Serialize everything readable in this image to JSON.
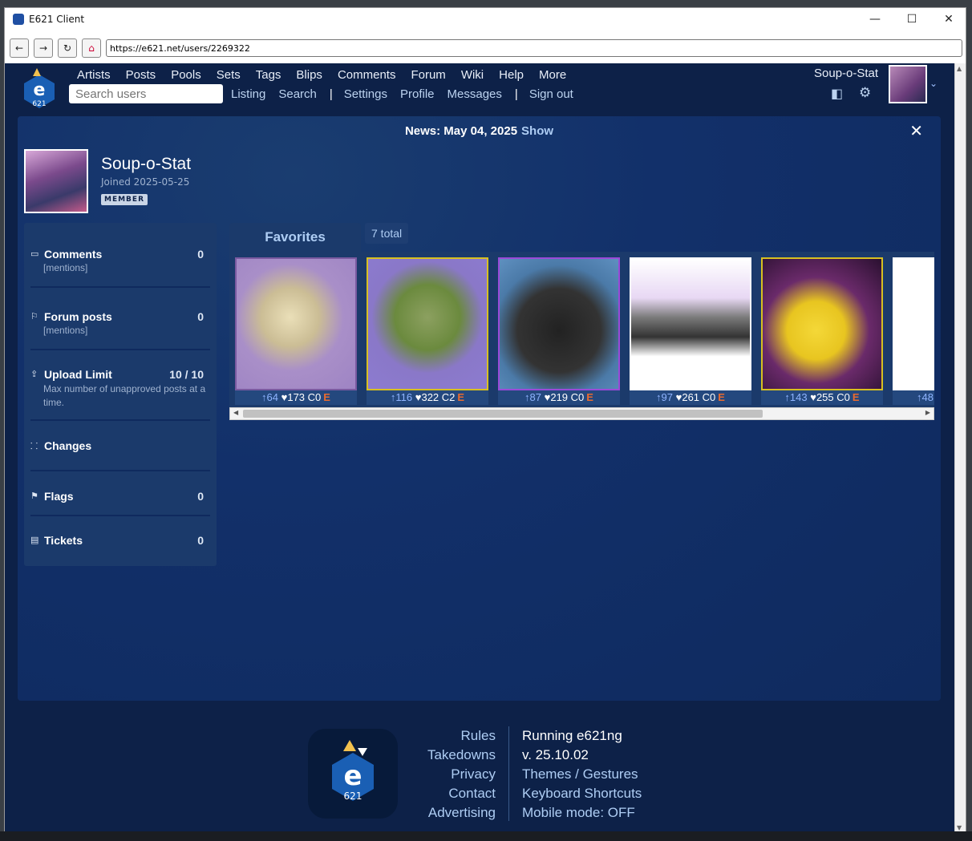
{
  "window": {
    "title": "E621 Client",
    "minimize": "—",
    "maximize": "☐",
    "close": "✕"
  },
  "addressbar": {
    "back": "←",
    "forward": "→",
    "reload": "↻",
    "url": "https://e621.net/users/2269322"
  },
  "nav": {
    "top": [
      "Artists",
      "Posts",
      "Pools",
      "Sets",
      "Tags",
      "Blips",
      "Comments",
      "Forum",
      "Wiki",
      "Help",
      "More"
    ],
    "search_placeholder": "Search users",
    "sub": [
      "Listing",
      "Search",
      "Settings",
      "Profile",
      "Messages",
      "Sign out"
    ],
    "username": "Soup-o-Stat"
  },
  "news": {
    "text": "News: May 04, 2025",
    "show": "Show",
    "close": "✕"
  },
  "profile": {
    "name": "Soup-o-Stat",
    "joined": "Joined 2025-05-25",
    "badge": "MEMBER"
  },
  "stats": {
    "comments": {
      "label": "Comments",
      "count": "0",
      "sub": "[mentions]"
    },
    "forum": {
      "label": "Forum posts",
      "count": "0",
      "sub": "[mentions]"
    },
    "upload": {
      "label": "Upload Limit",
      "count": "10 / 10",
      "sub": "Max number of unapproved posts at a time."
    },
    "changes": {
      "label": "Changes"
    },
    "flags": {
      "label": "Flags",
      "count": "0"
    },
    "tickets": {
      "label": "Tickets",
      "count": "0"
    }
  },
  "favorites": {
    "tab": "Favorites",
    "total": "7 total",
    "items": [
      {
        "score": "↑64",
        "favs": "♥173",
        "comments": "C0",
        "rating": "E",
        "border": "#7a5aa0"
      },
      {
        "score": "↑116",
        "favs": "♥322",
        "comments": "C2",
        "rating": "E",
        "border": "#d8c020"
      },
      {
        "score": "↑87",
        "favs": "♥219",
        "comments": "C0",
        "rating": "E",
        "border": "#9a4ad8"
      },
      {
        "score": "↑97",
        "favs": "♥261",
        "comments": "C0",
        "rating": "E",
        "border": "#ffffff"
      },
      {
        "score": "↑143",
        "favs": "♥255",
        "comments": "C0",
        "rating": "E",
        "border": "#d8c020"
      },
      {
        "score": "↑48",
        "favs": "",
        "comments": "",
        "rating": "",
        "border": "#ffffff"
      }
    ]
  },
  "footer": {
    "left": [
      "Rules",
      "Takedowns",
      "Privacy",
      "Contact",
      "Advertising"
    ],
    "right": [
      "Running e621ng",
      "v. 25.10.02",
      "Themes / Gestures",
      "Keyboard Shortcuts",
      "Mobile mode: OFF"
    ]
  }
}
